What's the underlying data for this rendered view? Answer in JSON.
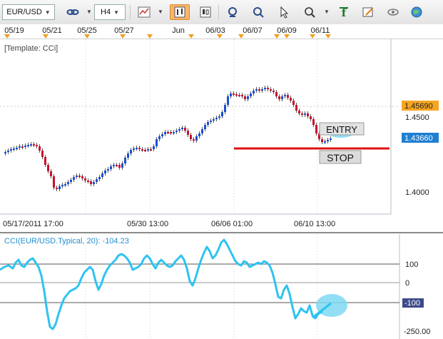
{
  "toolbar": {
    "symbol": "EUR/USD",
    "timeframe": "H4",
    "icons": [
      "link-icon",
      "chart-type-icon",
      "bar-chart-icon",
      "candle-chart-icon",
      "crosshair-icon",
      "zoom-in-icon",
      "zoom-out-icon",
      "cursor-icon",
      "magnifier-icon",
      "indicator-icon",
      "draw-icon",
      "eye-icon",
      "globe-icon"
    ]
  },
  "top_dates": [
    "05/19",
    "05/21",
    "05/25",
    "05/27",
    "Jun",
    "06/03",
    "06/07",
    "06/09",
    "06/11"
  ],
  "main_chart": {
    "template_label": "[Template: CCi]",
    "price_ticks": [
      "1.4500",
      "1.4000"
    ],
    "badge_high": "1.45690",
    "badge_current": "1.43660",
    "entry_label": "ENTRY",
    "stop_label": "STOP",
    "bottom_dates": [
      "05/17/2011 17:00",
      "05/30 13:00",
      "06/06 01:00",
      "06/10 13:00"
    ],
    "colors": {
      "up": "#1a4fd6",
      "down": "#c8102e",
      "stop_line": "#e01010",
      "badge_high": "#f5a623",
      "badge_current": "#1f7fd1"
    }
  },
  "cci": {
    "title": "CCI(EUR/USD.Typical, 20): -104.23",
    "ticks": [
      "100",
      "0",
      "-100",
      "-250.00"
    ],
    "line_color": "#2ec3f0"
  }
}
